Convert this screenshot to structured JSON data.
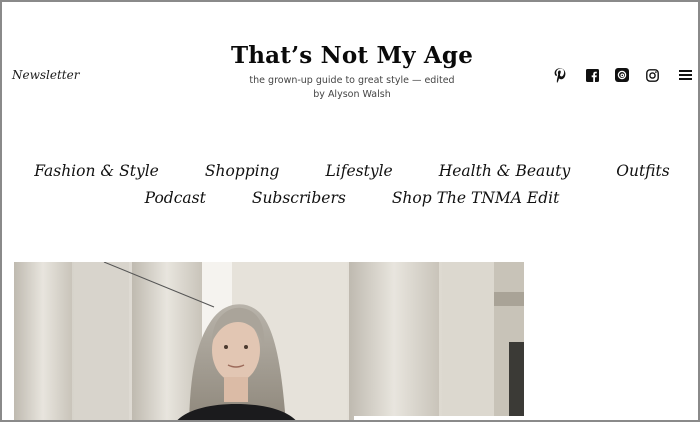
{
  "header": {
    "newsletter_label": "Newsletter",
    "site_title": "That’s Not My Age",
    "tagline": "the grown-up guide to great style — edited by Alyson Walsh"
  },
  "social": [
    {
      "icon": "pinterest-icon"
    },
    {
      "icon": "facebook-icon"
    },
    {
      "icon": "threads-icon"
    },
    {
      "icon": "instagram-icon"
    },
    {
      "icon": "hamburger-menu-icon"
    }
  ],
  "nav": {
    "row1": [
      "Fashion & Style",
      "Shopping",
      "Lifestyle",
      "Health & Beauty",
      "Outfits"
    ],
    "row2": [
      "Podcast",
      "Subscribers",
      "Shop The TNMA Edit"
    ]
  },
  "colors": {
    "text": "#111111",
    "border": "#8a8a8a",
    "background": "#ffffff"
  }
}
